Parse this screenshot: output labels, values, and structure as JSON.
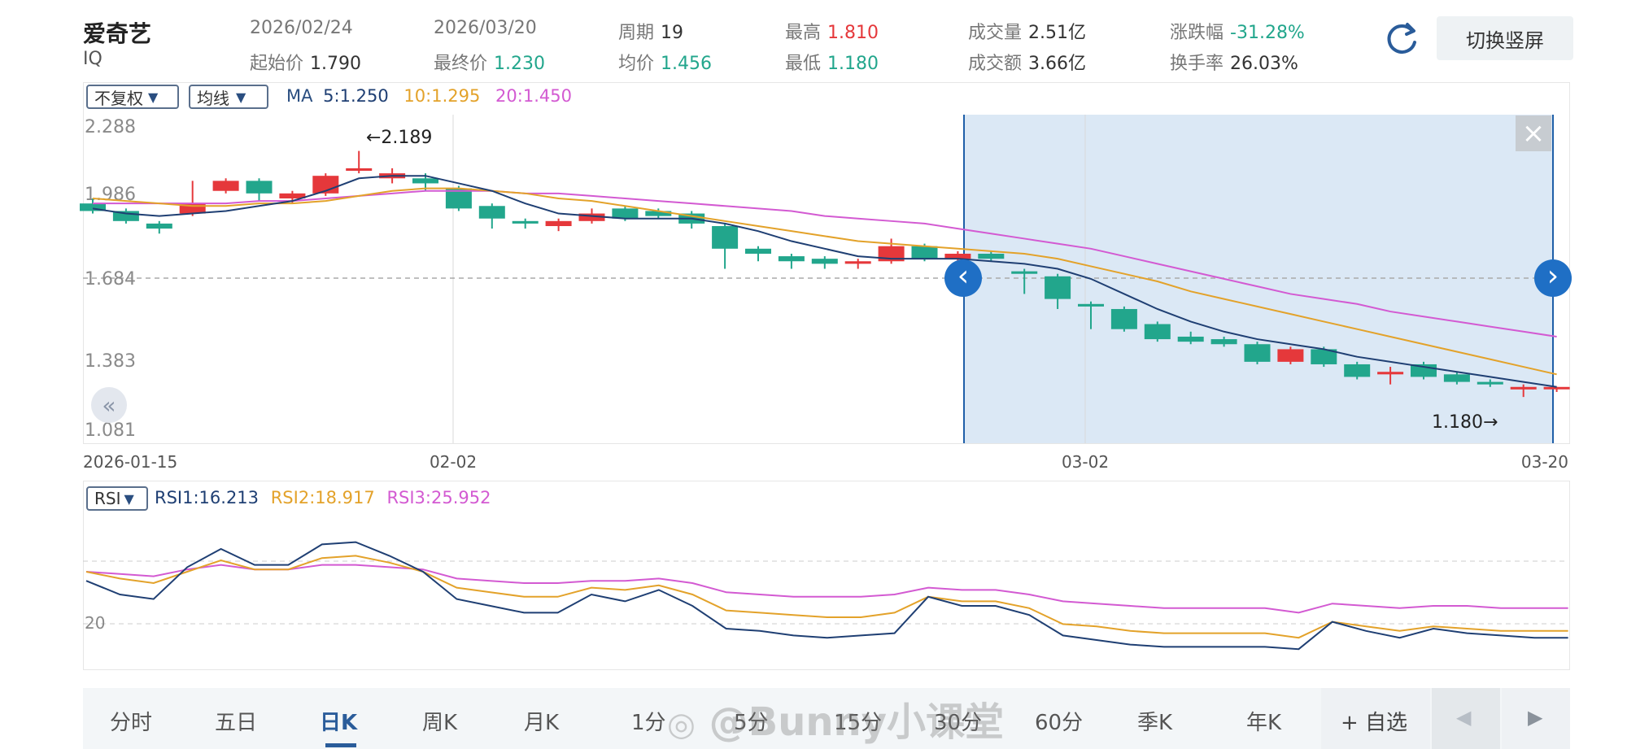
{
  "stock": {
    "name": "爱奇艺",
    "code": "IQ"
  },
  "header": {
    "start_date": "2026/02/24",
    "end_date": "2026/03/20",
    "period_label": "周期",
    "period_value": "19",
    "high_label": "最高",
    "high_value": "1.810",
    "low_label": "最低",
    "low_value": "1.180",
    "volume_label": "成交量",
    "volume_value": "2.51亿",
    "amount_label": "成交额",
    "amount_value": "3.66亿",
    "change_label": "涨跌幅",
    "change_value": "-31.28%",
    "turnover_label": "换手率",
    "turnover_value": "26.03%",
    "open_label": "起始价",
    "open_value": "1.790",
    "close_label": "最终价",
    "close_value": "1.230",
    "avg_label": "均价",
    "avg_value": "1.456",
    "switch_button": "切换竖屏"
  },
  "kline": {
    "adjust_select": "不复权",
    "indicator_select": "均线",
    "ma_label": "MA",
    "ma5": "5:1.250",
    "ma10": "10:1.295",
    "ma20": "20:1.450",
    "y_ticks": [
      "2.288",
      "1.986",
      "1.684",
      "1.383",
      "1.081"
    ],
    "x_ticks": [
      "2026-01-15",
      "02-02",
      "03-02",
      "03-20"
    ],
    "max_annotation": "←2.189",
    "min_annotation": "1.180→",
    "close_icon": "×",
    "collapse_icon": "«",
    "left_arrow": "‹",
    "right_arrow": "›"
  },
  "rsi": {
    "select": "RSI",
    "rsi1": "RSI1:16.213",
    "rsi2": "RSI2:18.917",
    "rsi3": "RSI3:25.952",
    "y_tick": "20"
  },
  "tabs": [
    "分时",
    "五日",
    "日K",
    "周K",
    "月K",
    "1分",
    "5分",
    "15分",
    "30分",
    "60分",
    "季K",
    "年K"
  ],
  "active_tab": "日K",
  "add_watchlist": "+ 自选",
  "watermark": "@Bunny小课堂",
  "colors": {
    "up": "#e5383b",
    "down": "#22a68c",
    "ma5": "#1f3f73",
    "ma10": "#e3a22a",
    "ma20": "#d35ad2",
    "accent": "#1f6fc5"
  },
  "chart_data": {
    "type": "candlestick",
    "ylim": [
      1.081,
      2.288
    ],
    "candles": [
      {
        "o": 1.98,
        "c": 1.95,
        "h": 2.0,
        "l": 1.94
      },
      {
        "o": 1.95,
        "c": 1.91,
        "h": 1.96,
        "l": 1.9
      },
      {
        "o": 1.9,
        "c": 1.88,
        "h": 1.91,
        "l": 1.86
      },
      {
        "o": 1.94,
        "c": 1.98,
        "h": 2.07,
        "l": 1.93
      },
      {
        "o": 2.03,
        "c": 2.07,
        "h": 2.08,
        "l": 2.02
      },
      {
        "o": 2.07,
        "c": 2.02,
        "h": 2.08,
        "l": 1.99
      },
      {
        "o": 2.0,
        "c": 2.02,
        "h": 2.03,
        "l": 1.98
      },
      {
        "o": 2.02,
        "c": 2.09,
        "h": 2.1,
        "l": 2.01
      },
      {
        "o": 2.11,
        "c": 2.12,
        "h": 2.189,
        "l": 2.1
      },
      {
        "o": 2.08,
        "c": 2.1,
        "h": 2.12,
        "l": 2.06
      },
      {
        "o": 2.08,
        "c": 2.06,
        "h": 2.1,
        "l": 2.03
      },
      {
        "o": 2.04,
        "c": 1.96,
        "h": 2.05,
        "l": 1.95
      },
      {
        "o": 1.97,
        "c": 1.92,
        "h": 1.98,
        "l": 1.88
      },
      {
        "o": 1.91,
        "c": 1.9,
        "h": 1.92,
        "l": 1.88
      },
      {
        "o": 1.89,
        "c": 1.91,
        "h": 1.92,
        "l": 1.87
      },
      {
        "o": 1.91,
        "c": 1.94,
        "h": 1.96,
        "l": 1.9
      },
      {
        "o": 1.96,
        "c": 1.92,
        "h": 1.97,
        "l": 1.91
      },
      {
        "o": 1.95,
        "c": 1.93,
        "h": 1.96,
        "l": 1.92
      },
      {
        "o": 1.94,
        "c": 1.9,
        "h": 1.95,
        "l": 1.88
      },
      {
        "o": 1.89,
        "c": 1.8,
        "h": 1.9,
        "l": 1.72
      },
      {
        "o": 1.8,
        "c": 1.78,
        "h": 1.81,
        "l": 1.75
      },
      {
        "o": 1.77,
        "c": 1.75,
        "h": 1.78,
        "l": 1.72
      },
      {
        "o": 1.76,
        "c": 1.74,
        "h": 1.77,
        "l": 1.72
      },
      {
        "o": 1.74,
        "c": 1.75,
        "h": 1.76,
        "l": 1.72
      },
      {
        "o": 1.75,
        "c": 1.81,
        "h": 1.84,
        "l": 1.74
      },
      {
        "o": 1.81,
        "c": 1.76,
        "h": 1.82,
        "l": 1.75
      },
      {
        "o": 1.76,
        "c": 1.78,
        "h": 1.79,
        "l": 1.75
      },
      {
        "o": 1.78,
        "c": 1.76,
        "h": 1.79,
        "l": 1.75
      },
      {
        "o": 1.71,
        "c": 1.7,
        "h": 1.72,
        "l": 1.62
      },
      {
        "o": 1.69,
        "c": 1.6,
        "h": 1.7,
        "l": 1.56
      },
      {
        "o": 1.58,
        "c": 1.57,
        "h": 1.59,
        "l": 1.48
      },
      {
        "o": 1.56,
        "c": 1.48,
        "h": 1.57,
        "l": 1.47
      },
      {
        "o": 1.5,
        "c": 1.44,
        "h": 1.51,
        "l": 1.43
      },
      {
        "o": 1.45,
        "c": 1.43,
        "h": 1.47,
        "l": 1.42
      },
      {
        "o": 1.44,
        "c": 1.42,
        "h": 1.45,
        "l": 1.41
      },
      {
        "o": 1.42,
        "c": 1.35,
        "h": 1.43,
        "l": 1.34
      },
      {
        "o": 1.35,
        "c": 1.4,
        "h": 1.41,
        "l": 1.34
      },
      {
        "o": 1.4,
        "c": 1.34,
        "h": 1.41,
        "l": 1.33
      },
      {
        "o": 1.34,
        "c": 1.29,
        "h": 1.35,
        "l": 1.28
      },
      {
        "o": 1.3,
        "c": 1.31,
        "h": 1.33,
        "l": 1.26
      },
      {
        "o": 1.34,
        "c": 1.29,
        "h": 1.35,
        "l": 1.28
      },
      {
        "o": 1.3,
        "c": 1.27,
        "h": 1.31,
        "l": 1.26
      },
      {
        "o": 1.27,
        "c": 1.26,
        "h": 1.28,
        "l": 1.25
      },
      {
        "o": 1.24,
        "c": 1.25,
        "h": 1.26,
        "l": 1.21
      },
      {
        "o": 1.25,
        "c": 1.25,
        "h": 1.25,
        "l": 1.23
      }
    ],
    "ma5": [
      1.96,
      1.94,
      1.93,
      1.94,
      1.95,
      1.97,
      1.99,
      2.03,
      2.08,
      2.09,
      2.09,
      2.06,
      2.03,
      1.98,
      1.94,
      1.93,
      1.92,
      1.92,
      1.92,
      1.9,
      1.87,
      1.83,
      1.8,
      1.77,
      1.76,
      1.76,
      1.76,
      1.75,
      1.74,
      1.72,
      1.68,
      1.62,
      1.56,
      1.51,
      1.47,
      1.44,
      1.42,
      1.4,
      1.37,
      1.35,
      1.33,
      1.31,
      1.29,
      1.27,
      1.25
    ],
    "ma10": [
      2.0,
      1.99,
      1.98,
      1.97,
      1.97,
      1.98,
      1.98,
      1.99,
      2.01,
      2.03,
      2.04,
      2.04,
      2.03,
      2.02,
      2.0,
      1.99,
      1.97,
      1.95,
      1.93,
      1.91,
      1.89,
      1.87,
      1.85,
      1.83,
      1.82,
      1.81,
      1.8,
      1.79,
      1.78,
      1.76,
      1.73,
      1.7,
      1.67,
      1.63,
      1.6,
      1.57,
      1.54,
      1.51,
      1.48,
      1.45,
      1.42,
      1.39,
      1.36,
      1.33,
      1.3
    ],
    "ma20": [
      1.98,
      1.98,
      1.98,
      1.98,
      1.98,
      1.99,
      1.99,
      2.0,
      2.01,
      2.02,
      2.03,
      2.03,
      2.03,
      2.02,
      2.02,
      2.01,
      2.0,
      1.99,
      1.98,
      1.97,
      1.96,
      1.95,
      1.93,
      1.92,
      1.91,
      1.9,
      1.88,
      1.86,
      1.84,
      1.82,
      1.8,
      1.77,
      1.74,
      1.71,
      1.68,
      1.65,
      1.62,
      1.6,
      1.58,
      1.55,
      1.53,
      1.51,
      1.49,
      1.47,
      1.45
    ],
    "rsi_ylim": [
      0,
      100
    ],
    "rsi1": [
      36,
      30,
      28,
      42,
      50,
      43,
      43,
      52,
      53,
      47,
      40,
      28,
      25,
      22,
      22,
      30,
      27,
      32,
      25,
      15,
      14,
      12,
      11,
      12,
      13,
      29,
      25,
      25,
      21,
      12,
      10,
      8,
      7,
      7,
      7,
      7,
      6,
      18,
      14,
      11,
      15,
      13,
      12,
      11,
      11
    ],
    "rsi2": [
      40,
      37,
      35,
      40,
      45,
      41,
      41,
      46,
      47,
      44,
      40,
      33,
      31,
      29,
      29,
      33,
      32,
      34,
      30,
      23,
      22,
      21,
      20,
      20,
      22,
      29,
      27,
      27,
      24,
      17,
      16,
      14,
      13,
      13,
      13,
      13,
      11,
      18,
      16,
      14,
      16,
      15,
      14,
      14,
      14
    ],
    "rsi3": [
      40,
      39,
      38,
      41,
      43,
      41,
      41,
      43,
      43,
      42,
      41,
      37,
      36,
      35,
      35,
      36,
      36,
      37,
      35,
      31,
      30,
      29,
      29,
      29,
      30,
      33,
      32,
      32,
      30,
      27,
      26,
      25,
      24,
      24,
      24,
      24,
      22,
      26,
      25,
      24,
      25,
      25,
      24,
      24,
      24
    ]
  }
}
